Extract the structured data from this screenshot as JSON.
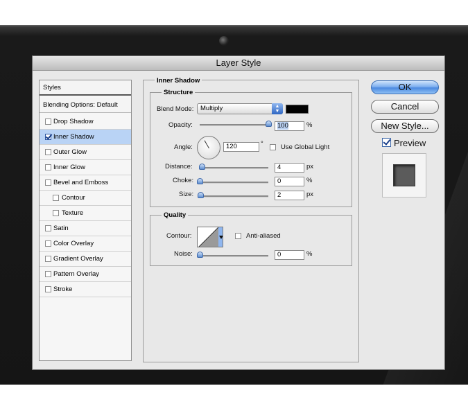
{
  "dialog": {
    "title": "Layer Style"
  },
  "styles_panel": {
    "header": "Styles",
    "blending": "Blending Options: Default",
    "items": [
      {
        "label": "Drop Shadow",
        "checked": false
      },
      {
        "label": "Inner Shadow",
        "checked": true,
        "selected": true
      },
      {
        "label": "Outer Glow",
        "checked": false
      },
      {
        "label": "Inner Glow",
        "checked": false
      },
      {
        "label": "Bevel and Emboss",
        "checked": false
      },
      {
        "label": "Contour",
        "checked": false,
        "sub": true
      },
      {
        "label": "Texture",
        "checked": false,
        "sub": true
      },
      {
        "label": "Satin",
        "checked": false
      },
      {
        "label": "Color Overlay",
        "checked": false
      },
      {
        "label": "Gradient Overlay",
        "checked": false
      },
      {
        "label": "Pattern Overlay",
        "checked": false
      },
      {
        "label": "Stroke",
        "checked": false
      }
    ]
  },
  "inner_shadow": {
    "title": "Inner Shadow",
    "structure": {
      "title": "Structure",
      "blend_mode_label": "Blend Mode:",
      "blend_mode_value": "Multiply",
      "shadow_color": "#000000",
      "opacity_label": "Opacity:",
      "opacity_value": "100",
      "opacity_unit": "%",
      "angle_label": "Angle:",
      "angle_value": "120",
      "angle_unit": "°",
      "global_light_label": "Use Global Light",
      "global_light_checked": false,
      "distance_label": "Distance:",
      "distance_value": "4",
      "distance_unit": "px",
      "choke_label": "Choke:",
      "choke_value": "0",
      "choke_unit": "%",
      "size_label": "Size:",
      "size_value": "2",
      "size_unit": "px"
    },
    "quality": {
      "title": "Quality",
      "contour_label": "Contour:",
      "anti_aliased_label": "Anti-aliased",
      "anti_aliased_checked": false,
      "noise_label": "Noise:",
      "noise_value": "0",
      "noise_unit": "%"
    }
  },
  "buttons": {
    "ok": "OK",
    "cancel": "Cancel",
    "new_style": "New Style...",
    "preview_label": "Preview",
    "preview_checked": true
  },
  "colors": {
    "accent": "#5a92e4",
    "selection": "#b9d3f5",
    "dialog_bg": "#e8e8e8",
    "device_bg": "#1a1a1a"
  }
}
